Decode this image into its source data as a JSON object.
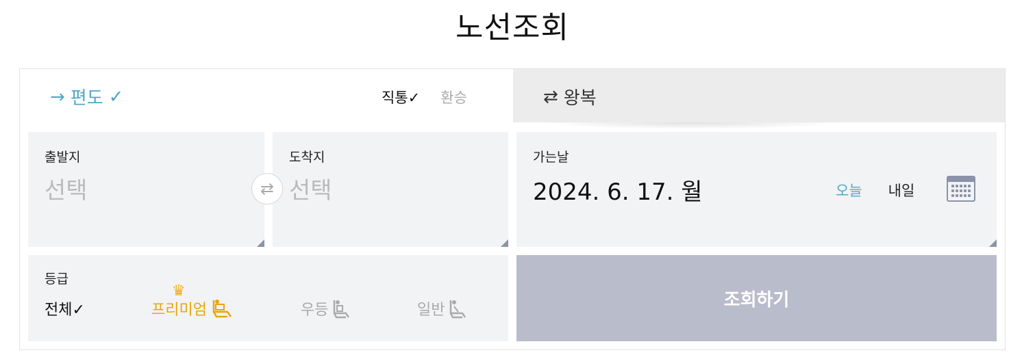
{
  "page": {
    "title": "노선조회"
  },
  "trip_type": {
    "oneway": {
      "arrow": "→",
      "label": "편도",
      "check": "✓"
    },
    "roundtrip": {
      "arrow": "⇄",
      "label": "왕복"
    },
    "route": {
      "direct": "직통✓",
      "transfer": "환승"
    }
  },
  "departure": {
    "label": "출발지",
    "value": "선택"
  },
  "arrival": {
    "label": "도착지",
    "value": "선택"
  },
  "swap": {
    "glyph": "⇄"
  },
  "date": {
    "label": "가는날",
    "value": "2024. 6. 17. 월",
    "today": "오늘",
    "tomorrow": "내일"
  },
  "grade": {
    "label": "등급",
    "options": {
      "all": "전체✓",
      "premium": "프리미엄",
      "first": "우등",
      "normal": "일반"
    }
  },
  "search": {
    "label": "조회하기"
  },
  "colors": {
    "accent": "#4fa7c5",
    "premium": "#e7a70a",
    "button": "#b8bccb"
  }
}
